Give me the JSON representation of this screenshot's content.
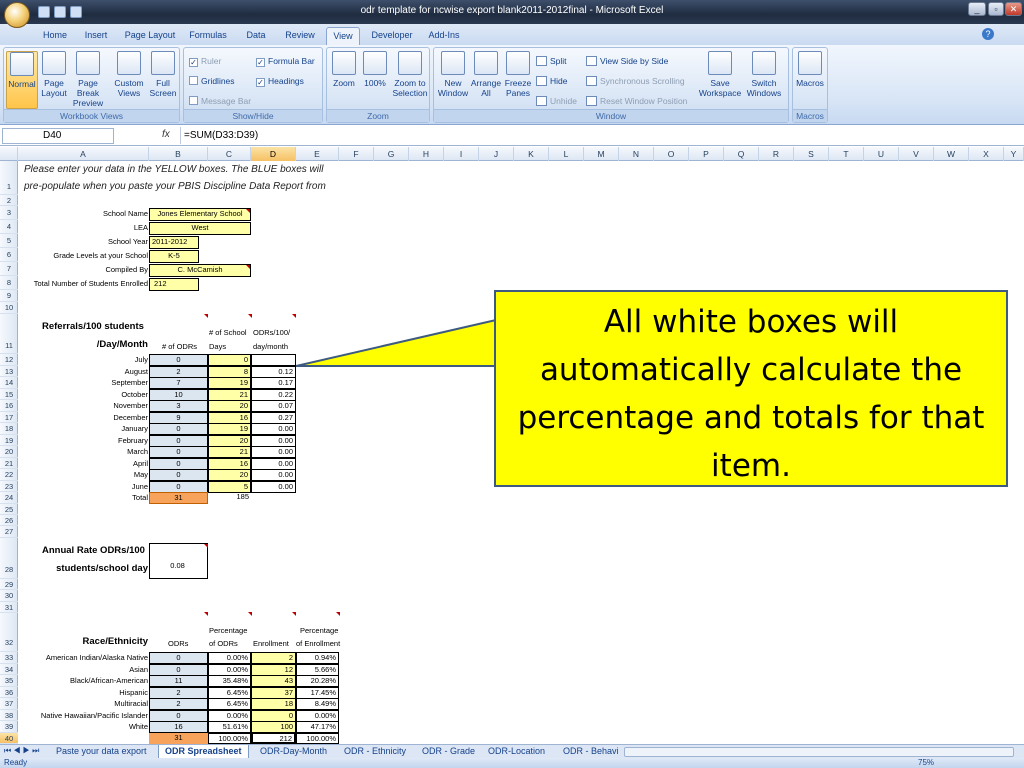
{
  "window": {
    "title": "odr template for ncwise export blank2011-2012final - Microsoft Excel"
  },
  "ribbon_tabs": [
    "Home",
    "Insert",
    "Page Layout",
    "Formulas",
    "Data",
    "Review",
    "View",
    "Developer",
    "Add-Ins"
  ],
  "ribbon": {
    "workbook_views": {
      "label": "Workbook Views",
      "normal": "Normal",
      "page_layout": "Page Layout",
      "page_break": "Page Break Preview",
      "custom": "Custom Views",
      "full": "Full Screen"
    },
    "show_hide": {
      "label": "Show/Hide",
      "ruler": "Ruler",
      "formula_bar": "Formula Bar",
      "gridlines": "Gridlines",
      "headings": "Headings",
      "message_bar": "Message Bar"
    },
    "zoom": {
      "label": "Zoom",
      "zoom": "Zoom",
      "hundred": "100%",
      "zoom_sel": "Zoom to Selection"
    },
    "window": {
      "label": "Window",
      "new_window": "New Window",
      "arrange_all": "Arrange All",
      "freeze": "Freeze Panes",
      "split": "Split",
      "hide": "Hide",
      "unhide": "Unhide",
      "side_by_side": "View Side by Side",
      "sync_scroll": "Synchronous Scrolling",
      "reset_pos": "Reset Window Position",
      "save_ws": "Save Workspace",
      "switch": "Switch Windows"
    },
    "macros": {
      "label": "Macros",
      "macros": "Macros"
    }
  },
  "formula_bar": {
    "name_box": "D40",
    "fx": "fx",
    "formula": "=SUM(D33:D39)"
  },
  "columns": [
    "A",
    "B",
    "C",
    "D",
    "E",
    "F",
    "G",
    "H",
    "I",
    "J",
    "K",
    "L",
    "M",
    "N",
    "O",
    "P",
    "Q",
    "R",
    "S",
    "T",
    "U",
    "V",
    "W",
    "X",
    "Y"
  ],
  "rows": [
    "1",
    "2",
    "3",
    "4",
    "5",
    "6",
    "7",
    "8",
    "9",
    "10",
    "11",
    "12",
    "13",
    "14",
    "15",
    "16",
    "17",
    "18",
    "19",
    "20",
    "21",
    "22",
    "23",
    "24",
    "25",
    "26",
    "27",
    "28",
    "29",
    "30",
    "31",
    "32",
    "33",
    "34",
    "35",
    "36",
    "37",
    "38",
    "39",
    "40"
  ],
  "intro": {
    "line1": "Please enter your data in the YELLOW boxes. The BLUE boxes will",
    "line2": "pre-populate when you paste your PBIS Discipline Data Report from"
  },
  "school_info": [
    {
      "label": "School Name",
      "value": "Jones Elementary School"
    },
    {
      "label": "LEA",
      "value": "West"
    },
    {
      "label": "School Year",
      "value": "2011-2012"
    },
    {
      "label": "Grade Levels at your School",
      "value": "K-5"
    },
    {
      "label": "Compiled By",
      "value": "C. McCamish"
    },
    {
      "label": "Total Number of Students Enrolled",
      "value": "212"
    }
  ],
  "referrals": {
    "title1": "Referrals/100 students",
    "title2": "/Day/Month",
    "col_odrs": "# of ODRs",
    "col_days1": "# of School",
    "col_days2": "Days",
    "col_rate1": "ODRs/100/",
    "col_rate2": "day/month",
    "months": [
      {
        "m": "July",
        "odrs": "0",
        "days": "0",
        "rate": ""
      },
      {
        "m": "August",
        "odrs": "2",
        "days": "8",
        "rate": "0.12"
      },
      {
        "m": "September",
        "odrs": "7",
        "days": "19",
        "rate": "0.17"
      },
      {
        "m": "October",
        "odrs": "10",
        "days": "21",
        "rate": "0.22"
      },
      {
        "m": "November",
        "odrs": "3",
        "days": "20",
        "rate": "0.07"
      },
      {
        "m": "December",
        "odrs": "9",
        "days": "16",
        "rate": "0.27"
      },
      {
        "m": "January",
        "odrs": "0",
        "days": "19",
        "rate": "0.00"
      },
      {
        "m": "February",
        "odrs": "0",
        "days": "20",
        "rate": "0.00"
      },
      {
        "m": "March",
        "odrs": "0",
        "days": "21",
        "rate": "0.00"
      },
      {
        "m": "April",
        "odrs": "0",
        "days": "16",
        "rate": "0.00"
      },
      {
        "m": "May",
        "odrs": "0",
        "days": "20",
        "rate": "0.00"
      },
      {
        "m": "June",
        "odrs": "0",
        "days": "5",
        "rate": "0.00"
      }
    ],
    "total_label": "Total",
    "total_odrs": "31",
    "total_days": "185"
  },
  "annual": {
    "title1": "Annual Rate ODRs/100",
    "title2": "students/school day",
    "value": "0.08"
  },
  "race": {
    "title": "Race/Ethnicity",
    "col_odrs": "ODRs",
    "col_pct1": "Percentage",
    "col_pct2": "of ODRs",
    "col_enr": "Enrollment",
    "col_pcte1": "Percentage",
    "col_pcte2": "of Enrollment",
    "rows": [
      {
        "name": "American Indian/Alaska Native",
        "odrs": "0",
        "pct": "0.00%",
        "enr": "2",
        "pcte": "0.94%"
      },
      {
        "name": "Asian",
        "odrs": "0",
        "pct": "0.00%",
        "enr": "12",
        "pcte": "5.66%"
      },
      {
        "name": "Black/African-American",
        "odrs": "11",
        "pct": "35.48%",
        "enr": "43",
        "pcte": "20.28%"
      },
      {
        "name": "Hispanic",
        "odrs": "2",
        "pct": "6.45%",
        "enr": "37",
        "pcte": "17.45%"
      },
      {
        "name": "Multiracial",
        "odrs": "2",
        "pct": "6.45%",
        "enr": "18",
        "pcte": "8.49%"
      },
      {
        "name": "Native Hawaiian/Pacific Islander",
        "odrs": "0",
        "pct": "0.00%",
        "enr": "0",
        "pcte": "0.00%"
      },
      {
        "name": "White",
        "odrs": "16",
        "pct": "51.61%",
        "enr": "100",
        "pcte": "47.17%"
      }
    ],
    "total_odrs": "31",
    "total_pct": "100.00%",
    "total_enr": "212",
    "total_pcte": "100.00%"
  },
  "callout": {
    "text": "All white boxes will automatically calculate the percentage and totals for that item."
  },
  "sheet_tabs": [
    "Paste your data export",
    "ODR Spreadsheet",
    "ODR-Day-Month",
    "ODR - Ethnicity",
    "ODR - Grade",
    "ODR-Location",
    "ODR - Behavi"
  ],
  "active_sheet": "ODR Spreadsheet",
  "status": {
    "ready": "Ready",
    "zoom": "75%"
  },
  "colors": {
    "yellow_input": "#ffffa8",
    "blue_prepop": "#dce6f1",
    "total_orange": "#f7a35c",
    "callout": "#ffff00"
  }
}
